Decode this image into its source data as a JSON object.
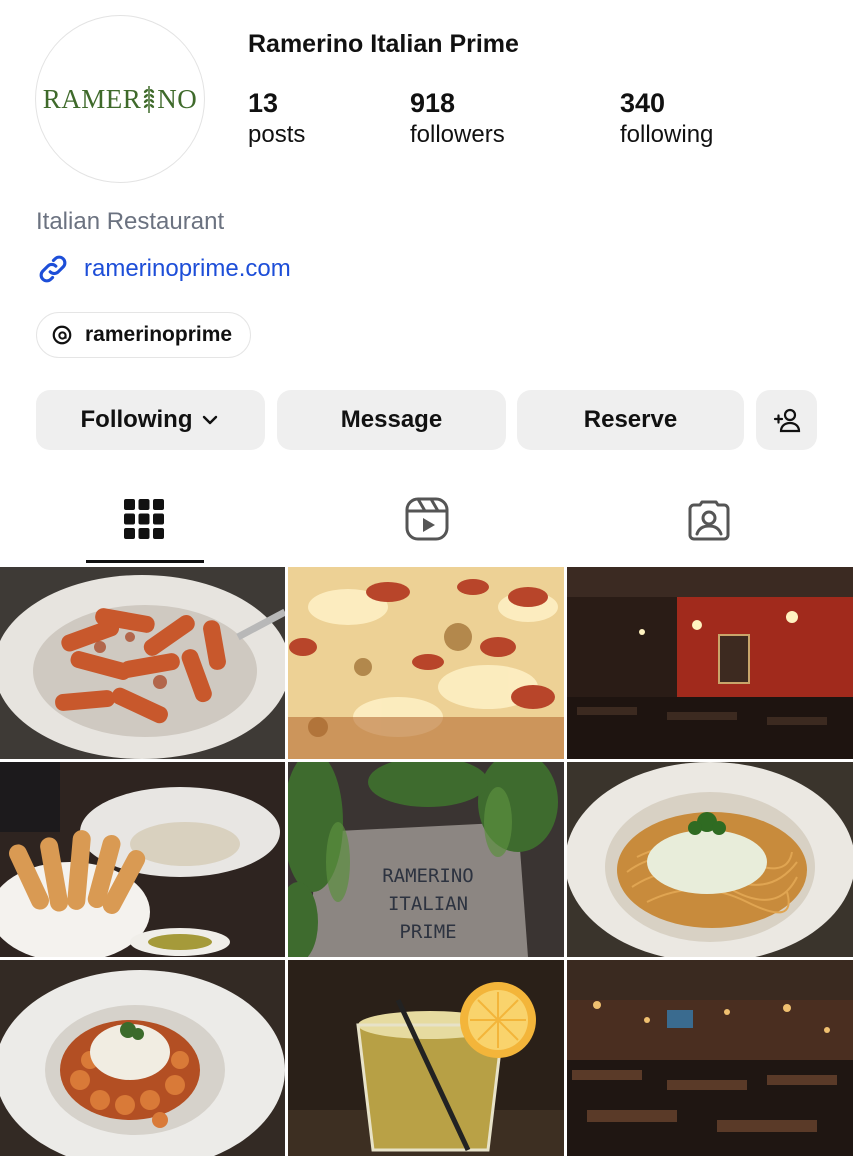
{
  "profile": {
    "logo_text": "RAMERINO",
    "name": "Ramerino Italian Prime",
    "stats": [
      {
        "value": "13",
        "label": "posts"
      },
      {
        "value": "918",
        "label": "followers"
      },
      {
        "value": "340",
        "label": "following"
      }
    ],
    "category": "Italian Restaurant",
    "website": "ramerinoprime.com",
    "threads_handle": "ramerinoprime"
  },
  "actions": {
    "following_label": "Following",
    "message_label": "Message",
    "reserve_label": "Reserve",
    "add_user_icon": "add-person-icon"
  },
  "tabs": [
    {
      "name": "posts-grid",
      "icon": "grid-icon",
      "active": true
    },
    {
      "name": "reels",
      "icon": "reels-icon",
      "active": false
    },
    {
      "name": "tagged",
      "icon": "tagged-person-icon",
      "active": false
    }
  ],
  "posts": [
    {
      "subject": "penne pasta with tomato sauce"
    },
    {
      "subject": "cheese and pepperoni pizza"
    },
    {
      "subject": "dim restaurant dining room with red walls"
    },
    {
      "subject": "breadsticks with creamy soup"
    },
    {
      "subject": "RAMERINO ITALIAN PRIME sign with plants"
    },
    {
      "subject": "spaghetti with cream sauce and parsley"
    },
    {
      "subject": "gnocchi with tomato sauce and cheese"
    },
    {
      "subject": "cocktail with lemon slice"
    },
    {
      "subject": "dark dining room with tables"
    }
  ],
  "sign_text": [
    "RAMERINO",
    "ITALIAN",
    "PRIME"
  ],
  "colors": {
    "link": "#1d4ed8",
    "logo_green": "#3f6a2b",
    "button_bg": "#efefef",
    "muted_text": "#6b7280"
  }
}
